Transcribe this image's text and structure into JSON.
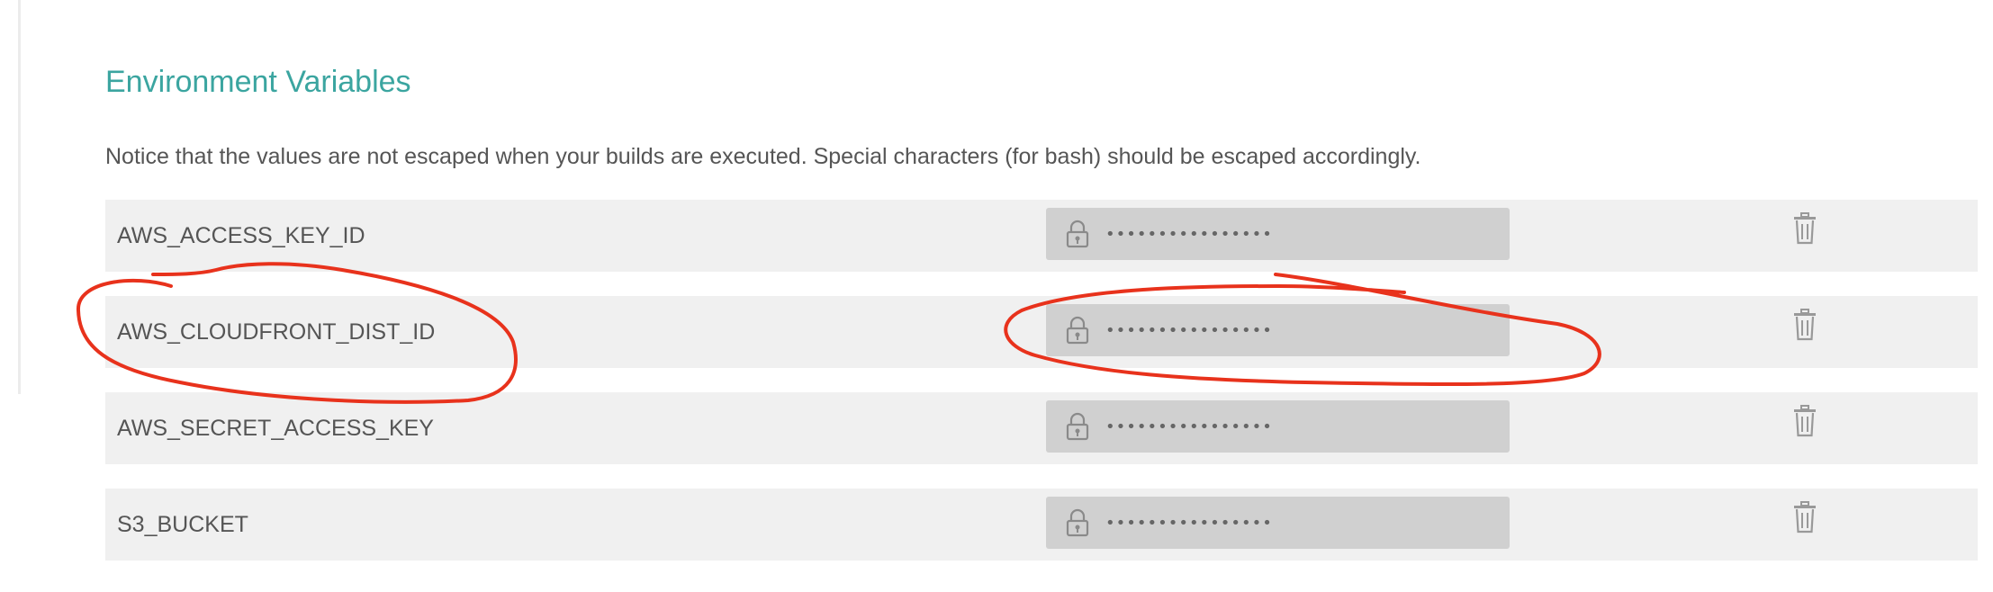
{
  "section": {
    "title": "Environment Variables",
    "notice": "Notice that the values are not escaped when your builds are executed. Special characters (for bash) should be escaped accordingly."
  },
  "env_vars": [
    {
      "name": "AWS_ACCESS_KEY_ID",
      "masked_value": "••••••••••••••••"
    },
    {
      "name": "AWS_CLOUDFRONT_DIST_ID",
      "masked_value": "••••••••••••••••"
    },
    {
      "name": "AWS_SECRET_ACCESS_KEY",
      "masked_value": "••••••••••••••••"
    },
    {
      "name": "S3_BUCKET",
      "masked_value": "••••••••••••••••"
    }
  ],
  "icons": {
    "lock": "lock-icon",
    "delete": "trash-icon"
  },
  "colors": {
    "title": "#3ba5a0",
    "row_background": "#f0f0f0",
    "value_background": "#d0d0d0",
    "annotation": "#e8321c"
  }
}
